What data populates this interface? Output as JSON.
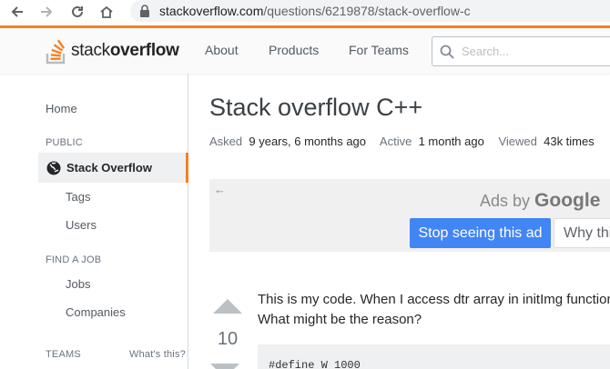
{
  "browser": {
    "url_host": "stackoverflow.com",
    "url_path": "/questions/6219878/stack-overflow-c"
  },
  "topbar": {
    "logo_light": "stack",
    "logo_bold": "overflow",
    "nav": [
      "About",
      "Products",
      "For Teams"
    ],
    "search_placeholder": "Search..."
  },
  "sidebar": {
    "home": "Home",
    "public_heading": "PUBLIC",
    "active_item": "Stack Overflow",
    "tags": "Tags",
    "users": "Users",
    "find_job_heading": "FIND A JOB",
    "jobs": "Jobs",
    "companies": "Companies",
    "teams_heading": "TEAMS",
    "whats_this": "What's this?"
  },
  "question": {
    "title": "Stack overflow C++",
    "asked_label": "Asked",
    "asked_value": "9 years, 6 months ago",
    "active_label": "Active",
    "active_value": "1 month ago",
    "viewed_label": "Viewed",
    "viewed_value": "43k times",
    "votes": "10",
    "body_line1": "This is my code. When I access dtr array in initImg function",
    "body_line2": "What might be the reason?",
    "code_line1": "#define W 1000"
  },
  "ad": {
    "back_arrow": "←",
    "ads_by": "Ads by",
    "google": "Google",
    "stop_label": "Stop seeing this ad",
    "why_label": "Why this ad?"
  },
  "colors": {
    "brand_orange": "#f48024",
    "google_blue": "#4285f4"
  }
}
